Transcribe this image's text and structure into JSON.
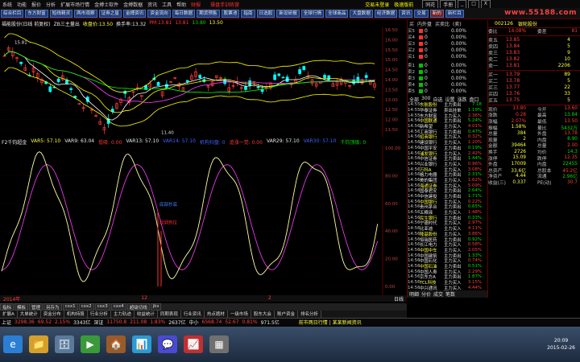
{
  "menu": {
    "items": [
      "系统",
      "功能",
      "报价",
      "分析",
      "扩展市场行情",
      "金搏士软件",
      "金搏数据",
      "资讯",
      "工具",
      "帮助"
    ],
    "highlight": "财报",
    "announcement": "操盘手训练营",
    "right_links": [
      "交易未登录",
      "极速版前"
    ],
    "win": [
      "同花",
      "手册",
      "_",
      "□",
      "X"
    ]
  },
  "toolbar": {
    "buttons": [
      "综合栏目",
      "东方财富",
      "短线精灵",
      "两市观察",
      "证券之星",
      "金搏资讯",
      "资金流向",
      "每日数据",
      "期货预售",
      "股票池",
      "指南",
      "日选股",
      "新设研报",
      "全球行情",
      "全球商品",
      "大盘数据",
      "经济数据",
      "资讯",
      "交易",
      "新的",
      "新栏目"
    ],
    "active_index": 19,
    "logo": "www.55188.com"
  },
  "chart_title": {
    "code": "福能股份(日线 前复权)",
    "indicator": "ZB三主量出",
    "price_label": "收盘价:13.50",
    "signal_label": "换手率:13.32",
    "pm_label": "PM:13.81",
    "t1": "13.81",
    "t2": "13.80",
    "t3": "13.50"
  },
  "kchart": {
    "yaxis": [
      "16.50",
      "16.00",
      "15.50",
      "15.00",
      "14.50",
      "14.00",
      "13.50",
      "13.00",
      "12.50",
      "12.00",
      "11.50"
    ],
    "hi_label": "15.81",
    "lo_label": "11.40"
  },
  "ind_title": {
    "name": "F2千钧超金",
    "var5": "VAR5: 57.10",
    "var5b": "VAR9: 63.04",
    "var6": "低吸: 0.00",
    "var7": "VAR13: 57.10",
    "var8": "VAR14: 57.10",
    "var9": "机构扫盘: 0",
    "var10": "追涨一觉: 0.00",
    "var11": "VAR29: 57.10",
    "var12": "VAR30: 57.10",
    "var13": "千钧顶级: 0"
  },
  "indchart": {
    "yaxis": [
      "100.00",
      "80.00",
      "60.00",
      "40.00",
      "20.00",
      "0.00"
    ],
    "label_a": "底部抄底",
    "label_b": "回调到位"
  },
  "timeaxis": {
    "t0": "2014年",
    "t1": "12",
    "t2": "2",
    "t3": "日线"
  },
  "subtabs": [
    "指标",
    "模板",
    "管理",
    "另存为",
    "cxx1",
    "cxx2",
    "cxx3",
    "cxx4",
    "超级切线",
    "jks"
  ],
  "bottabs": [
    "扩展A",
    "大单统计",
    "资金分布",
    "机构持股",
    "行业分析",
    "主力轨迹",
    "收益统计",
    "同期表现",
    "行业资讯",
    "热点题材",
    "一级市场",
    "股东大会",
    "账户资金",
    "排名分析"
  ],
  "status": {
    "sh_label": "上证",
    "sh_val": "3298.36",
    "sh_chg": "69.52",
    "sh_pct": "2.15%",
    "sh_amt": "3343亿",
    "sz_label": "深证",
    "sz_val": "11750.8",
    "sz_chg": "211.08",
    "sz_pct": "1.83%",
    "sz_amt": "2637亿",
    "zx_label": "中小",
    "zx_val": "6568.74",
    "zx_chg": "52.67",
    "zx_pct": "0.81%",
    "zx_amt": "971.5亿",
    "news": "前市两日行情 | 某某新闻资讯"
  },
  "taskbar": {
    "icons": [
      "e",
      "📁",
      "🗄",
      "▶",
      "🏠",
      "📊",
      "💬",
      "📈",
      "▦"
    ],
    "time": "20:09",
    "date": "2015-02-26"
  },
  "midpanel": {
    "head": [
      "买",
      "内外盘",
      "买卖比",
      "(卖)"
    ],
    "orders": [
      [
        "买5",
        "0",
        "0.00%"
      ],
      [
        "买4",
        "0",
        "0.00%"
      ],
      [
        "买3",
        "0",
        "0.00%"
      ],
      [
        "买2",
        "0",
        "0.00%"
      ],
      [
        "买1",
        "0",
        "0.00%"
      ],
      [
        "卖1",
        "0",
        "0.00%"
      ],
      [
        "卖2",
        "0",
        "0.00%"
      ],
      [
        "卖3",
        "0",
        "0.00%"
      ],
      [
        "卖4",
        "0",
        "0.00%"
      ],
      [
        "卖5",
        "0",
        "0.00%"
      ]
    ],
    "tabs": [
      "全部",
      "300",
      "自选",
      "设置",
      "涨跌",
      "盘口"
    ],
    "trades": [
      [
        "14:55",
        "东航股份",
        "主力卖出",
        "7.18"
      ],
      [
        "14:55",
        "华泰证券",
        "卖出挂单",
        "1.19%"
      ],
      [
        "14:55",
        "东方财富",
        "主力买入",
        "2.36%"
      ],
      [
        "14:56",
        "中国联通",
        "主力卖出",
        "5.24%"
      ],
      [
        "14:56",
        "新希望",
        "主力买入",
        "4.01%"
      ],
      [
        "14:56",
        "工商银行",
        "主力卖出",
        "0.47%"
      ],
      [
        "14:56",
        "招商银行",
        "主力买入",
        "0.32%"
      ],
      [
        "14:56",
        "建设银行",
        "主力买入",
        "1.20%"
      ],
      [
        "14:56",
        "中国平安",
        "主力卖出",
        "0.19%"
      ],
      [
        "14:56",
        "浦发银行",
        "主力买入",
        "2.42%"
      ],
      [
        "14:56",
        "中信证券",
        "主力卖出",
        "1.44%"
      ],
      [
        "14:56",
        "兴业银行",
        "主力买入",
        "0.96%"
      ],
      [
        "14:56",
        "万科A",
        "主力买入",
        "3.08%"
      ],
      [
        "14:56",
        "格力电器",
        "主力卖出",
        "2.31%"
      ],
      [
        "14:56",
        "美的集团",
        "主力买入",
        "1.62%"
      ],
      [
        "14:56",
        "海通证券",
        "主力买入",
        "5.09%"
      ],
      [
        "14:56",
        "国泰君安",
        "主力卖出",
        "2.64%"
      ],
      [
        "14:56",
        "中信建投",
        "主力卖出",
        "1.71%"
      ],
      [
        "14:56",
        "中国银行",
        "主力买入",
        "0.22%"
      ],
      [
        "14:56",
        "贵州茅台",
        "主力卖出",
        "0.65%"
      ],
      [
        "14:56",
        "五粮液",
        "主力买入",
        "1.48%"
      ],
      [
        "14:56",
        "民生银行",
        "主力卖出",
        "0.33%"
      ],
      [
        "14:56",
        "宁德时代",
        "主力买入",
        "2.97%"
      ],
      [
        "14:56",
        "比亚迪",
        "主力买入",
        "4.11%"
      ],
      [
        "14:56",
        "隆基股份",
        "主力买入",
        "3.86%"
      ],
      [
        "14:56",
        "恒瑞医药",
        "主力卖出",
        "0.92%"
      ],
      [
        "14:56",
        "长江电力",
        "主力买入",
        "0.58%"
      ],
      [
        "14:56",
        "中国中车",
        "主力买入",
        "2.05%"
      ],
      [
        "14:56",
        "中国建筑",
        "主力卖出",
        "1.33%"
      ],
      [
        "14:56",
        "中国石化",
        "主力买入",
        "0.74%"
      ],
      [
        "14:56",
        "中国石油",
        "主力卖出",
        "0.51%"
      ],
      [
        "14:56",
        "中国人寿",
        "主力买入",
        "2.29%"
      ],
      [
        "14:56",
        "京东方A",
        "主力卖出",
        "1.87%"
      ],
      [
        "14:56",
        "TCL科技",
        "主力买入",
        "3.15%"
      ],
      [
        "14:56",
        "中兴通讯",
        "主力买入",
        "4.44%"
      ],
      [
        "14:56",
        "科大讯飞",
        "主力卖出",
        "1.09%"
      ]
    ],
    "btm": [
      "明细",
      "分价",
      "成交",
      "笔数"
    ]
  },
  "rightpanel": {
    "symbol_code": "002126",
    "symbol_name": "银轮股份",
    "ratio_label": "委比",
    "ratio_val": "14.08%",
    "diff_label": "委差",
    "diff_val": "81",
    "sells": [
      [
        "卖五",
        "13.85",
        "4"
      ],
      [
        "卖四",
        "13.84",
        "5"
      ],
      [
        "卖三",
        "13.83",
        "9"
      ],
      [
        "卖二",
        "13.82",
        "10"
      ],
      [
        "卖一",
        "13.81",
        "2206"
      ]
    ],
    "buys": [
      [
        "买一",
        "13.79",
        "89"
      ],
      [
        "买二",
        "13.78",
        "5"
      ],
      [
        "买三",
        "13.77",
        "22"
      ],
      [
        "买四",
        "13.76",
        "33"
      ],
      [
        "买五",
        "13.75",
        "5"
      ]
    ],
    "stats": [
      [
        "现价",
        "13.80",
        "今开",
        "13.60"
      ],
      [
        "涨跌",
        "0.28",
        "最高",
        "13.84"
      ],
      [
        "涨幅",
        "2.07%",
        "最低",
        "13.50"
      ],
      [
        "振幅",
        "1.58%",
        "量比",
        "5432万"
      ],
      [
        "总量",
        "384",
        "外盘",
        "13.78"
      ],
      [
        "现量",
        "2",
        "内盘",
        "8.90"
      ],
      [
        "金额",
        "39464",
        "总量",
        "2.00"
      ],
      [
        "换手",
        "2726",
        "均价",
        "14.3"
      ],
      [
        "涨停",
        "15.09",
        "跌停",
        "12.35"
      ],
      [
        "外盘",
        "17009",
        "内盘",
        "22455"
      ],
      [
        "总资产",
        "33.6亿",
        "总股本",
        "45.2亿"
      ],
      [
        "净资产",
        "4.44",
        "流通",
        "2.96亿"
      ],
      [
        "收益(三)",
        "0.337",
        "PE(动)",
        "30.7"
      ]
    ]
  },
  "colors": {
    "bg": "#000000",
    "up": "#ff3b3b",
    "down": "#00ffff",
    "ma5": "#ffffff",
    "ma10": "#ffff00",
    "ma20": "#ff40ff",
    "ma60": "#00ff00",
    "accent": "#600000"
  }
}
